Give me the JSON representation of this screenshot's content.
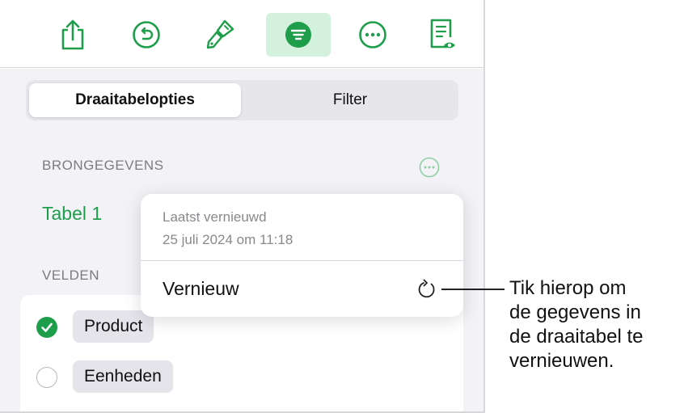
{
  "toolbar": {
    "buttons": [
      {
        "name": "share",
        "icon": "share-icon"
      },
      {
        "name": "undo",
        "icon": "undo-icon"
      },
      {
        "name": "format",
        "icon": "paintbrush-icon"
      },
      {
        "name": "organize",
        "icon": "filter-icon",
        "active": true
      },
      {
        "name": "more",
        "icon": "ellipsis-icon"
      },
      {
        "name": "document",
        "icon": "document-view-icon"
      }
    ]
  },
  "tabs": {
    "options": "Draaitabelopties",
    "filter": "Filter"
  },
  "source": {
    "label": "BRONGEGEVENS",
    "table_name": "Tabel 1"
  },
  "fields": {
    "label": "VELDEN",
    "items": [
      {
        "label": "Product",
        "checked": true
      },
      {
        "label": "Eenheden",
        "checked": false
      }
    ]
  },
  "popover": {
    "caption": "Laatst vernieuwd",
    "date": "25 juli 2024 om 11:18",
    "action": "Vernieuw"
  },
  "callout": {
    "lines": [
      "Tik hierop om",
      "de gegevens in",
      "de draaitabel te",
      "vernieuwen."
    ]
  },
  "colors": {
    "accent": "#1e9e4a",
    "active_bg": "#d4f1dd"
  }
}
